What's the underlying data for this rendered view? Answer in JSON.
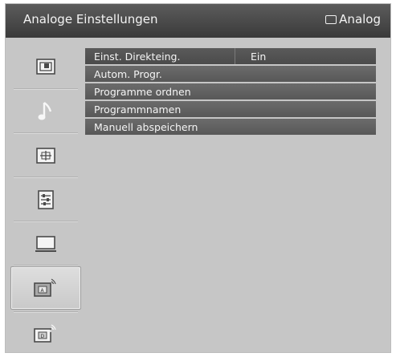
{
  "header": {
    "title": "Analoge Einstellungen",
    "source_label": "Analog"
  },
  "sidebar": {
    "items": [
      {
        "icon": "picture-icon"
      },
      {
        "icon": "music-note-icon"
      },
      {
        "icon": "screen-format-icon"
      },
      {
        "icon": "settings-list-icon"
      },
      {
        "icon": "monitor-icon"
      },
      {
        "icon": "analog-setup-icon",
        "selected": true
      },
      {
        "icon": "digital-setup-icon"
      }
    ]
  },
  "menu": {
    "items": [
      {
        "label": "Einst. Direkteing.",
        "value": "Ein"
      },
      {
        "label": "Autom. Progr."
      },
      {
        "label": "Programme ordnen"
      },
      {
        "label": "Programmnamen"
      },
      {
        "label": "Manuell abspeichern"
      }
    ]
  }
}
